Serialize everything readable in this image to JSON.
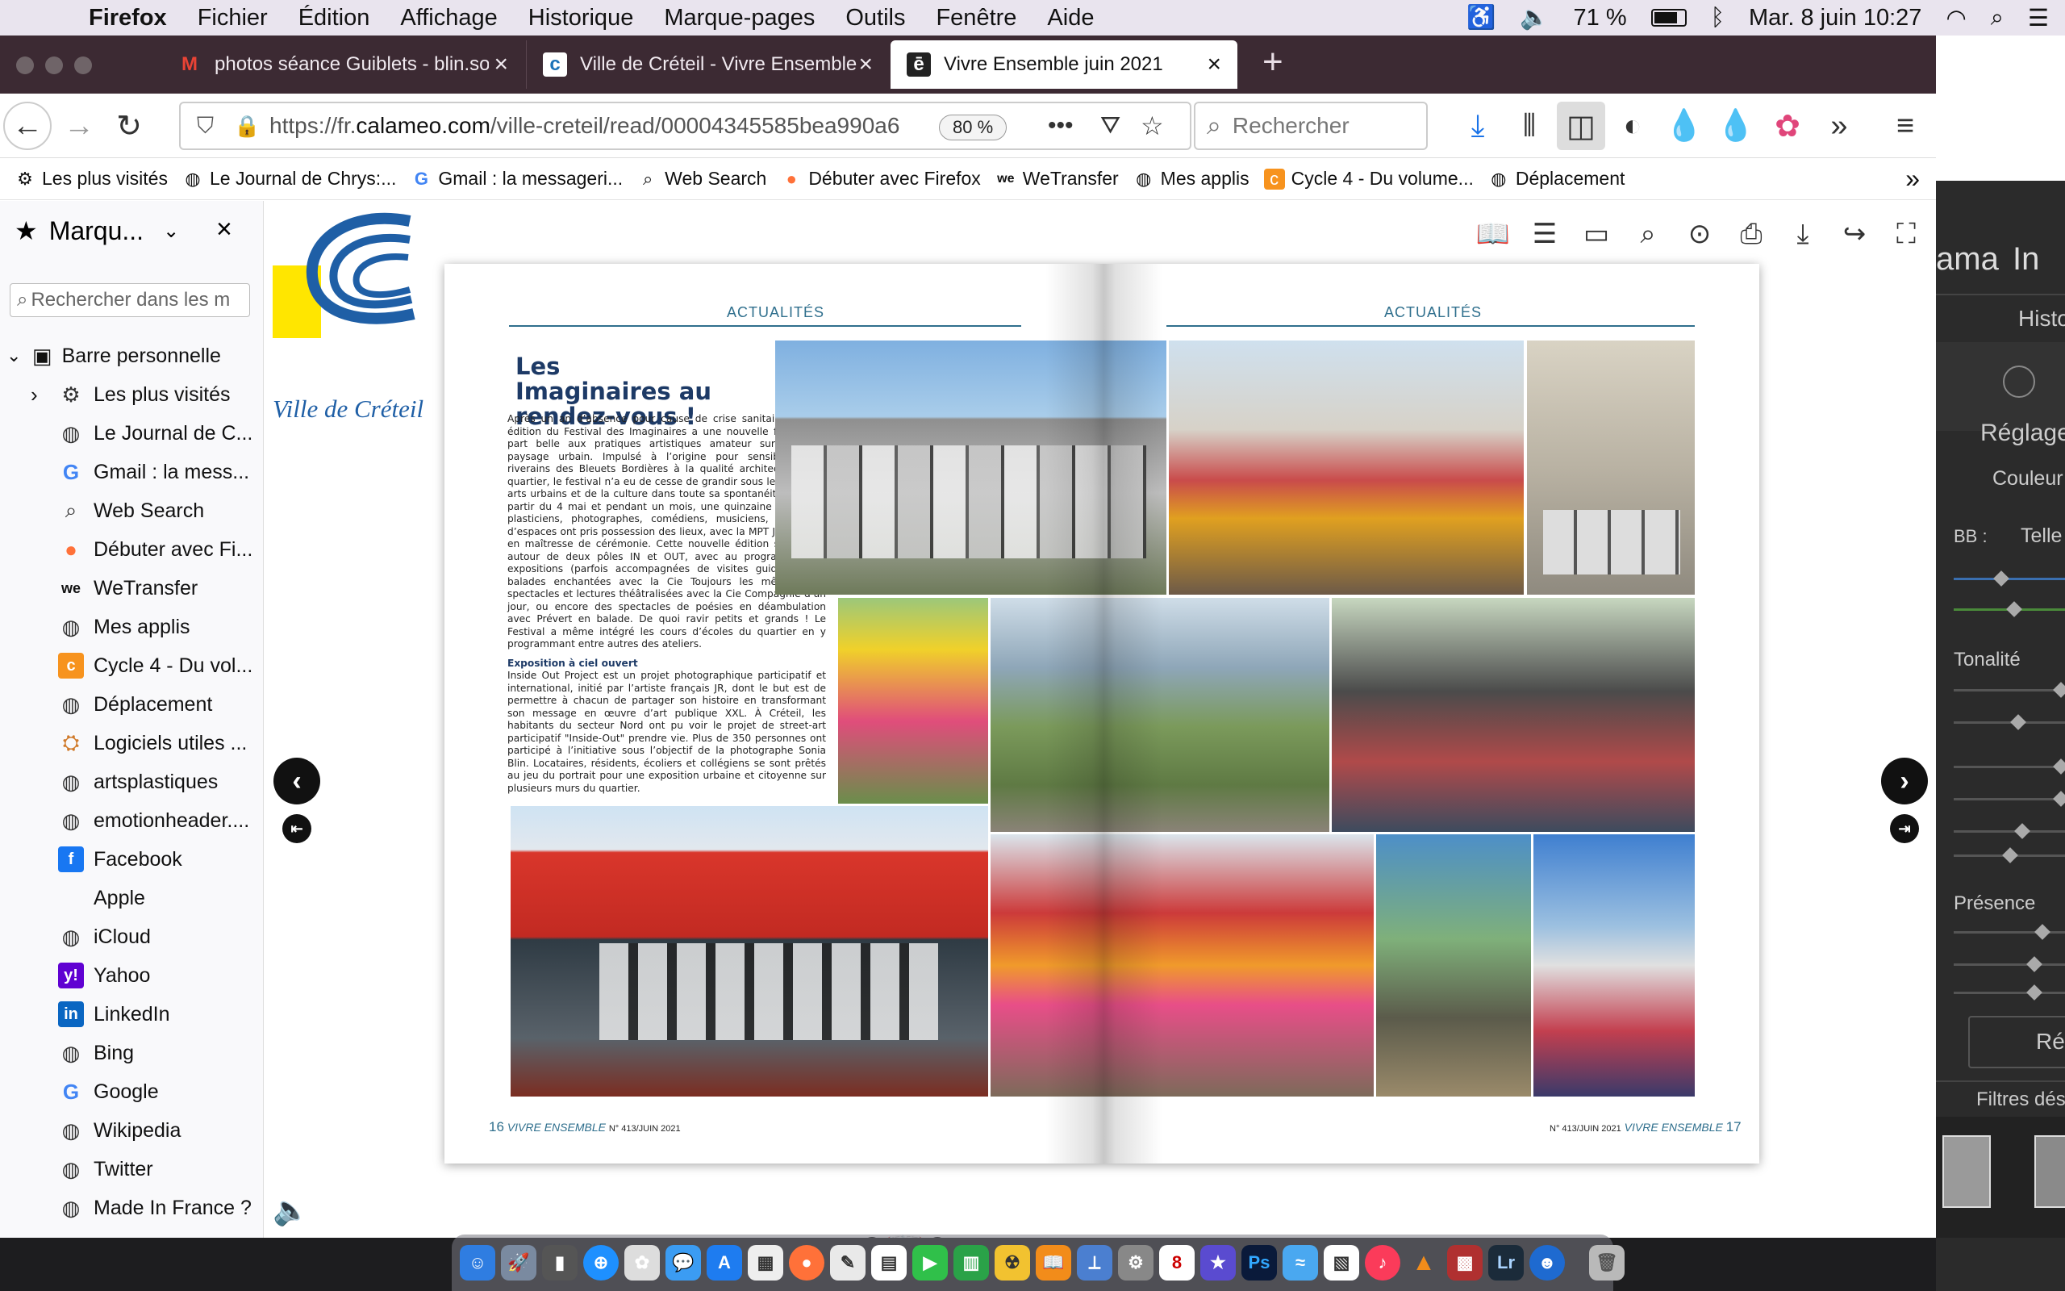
{
  "menubar": {
    "app": "Firefox",
    "menus": [
      "Fichier",
      "Édition",
      "Affichage",
      "Historique",
      "Marque-pages",
      "Outils",
      "Fenêtre",
      "Aide"
    ],
    "battery": "71 %",
    "datetime": "Mar. 8 juin  10:27"
  },
  "tabs": [
    {
      "label": "photos séance Guiblets - blin.sor",
      "icon": "gmail-icon"
    },
    {
      "label": "Ville de Créteil - Vivre Ensemble",
      "icon": "calameo-icon"
    },
    {
      "label": "Vivre Ensemble juin 2021",
      "icon": "calameo-icon"
    }
  ],
  "navbar": {
    "url_prefix": "https://fr.",
    "url_domain": "calameo.com",
    "url_path": "/ville-creteil/read/00004345585bea990a6",
    "zoom": "80 %",
    "search_placeholder": "Rechercher"
  },
  "bookmarks_toolbar": [
    {
      "label": "Les plus visités",
      "icon": "gear-icon"
    },
    {
      "label": "Le Journal de Chrys:...",
      "icon": "globe-icon"
    },
    {
      "label": "Gmail : la messageri...",
      "icon": "google-icon"
    },
    {
      "label": "Web Search",
      "icon": "search-icon"
    },
    {
      "label": "Débuter avec Firefox",
      "icon": "firefox-icon"
    },
    {
      "label": "WeTransfer",
      "icon": "wetransfer-icon"
    },
    {
      "label": "Mes applis",
      "icon": "globe-icon"
    },
    {
      "label": "Cycle 4 - Du volume...",
      "icon": "bookmark-app-icon"
    },
    {
      "label": "Déplacement",
      "icon": "globe-icon"
    }
  ],
  "sidebar": {
    "title": "Marqu...",
    "search_placeholder": "Rechercher dans les m",
    "root": "Barre personnelle",
    "items": [
      {
        "label": "Les plus visités",
        "icon": "gear-icon"
      },
      {
        "label": "Le Journal de C...",
        "icon": "globe-icon"
      },
      {
        "label": "Gmail : la mess...",
        "icon": "google-icon"
      },
      {
        "label": "Web Search",
        "icon": "search-icon"
      },
      {
        "label": "Débuter avec Fi...",
        "icon": "firefox-icon"
      },
      {
        "label": "WeTransfer",
        "icon": "wetransfer-icon"
      },
      {
        "label": "Mes applis",
        "icon": "globe-icon"
      },
      {
        "label": "Cycle 4 - Du vol...",
        "icon": "bookmark-app-icon"
      },
      {
        "label": "Déplacement",
        "icon": "globe-icon"
      },
      {
        "label": "Logiciels utiles ...",
        "icon": "software-icon"
      },
      {
        "label": "artsplastiques",
        "icon": "globe-icon"
      },
      {
        "label": "emotionheader....",
        "icon": "globe-icon"
      },
      {
        "label": "Facebook",
        "icon": "facebook-icon"
      },
      {
        "label": "Apple",
        "icon": "apple-icon"
      },
      {
        "label": "iCloud",
        "icon": "globe-icon"
      },
      {
        "label": "Yahoo",
        "icon": "yahoo-icon"
      },
      {
        "label": "LinkedIn",
        "icon": "linkedin-icon"
      },
      {
        "label": "Bing",
        "icon": "globe-icon"
      },
      {
        "label": "Google",
        "icon": "google-icon"
      },
      {
        "label": "Wikipedia",
        "icon": "globe-icon"
      },
      {
        "label": "Twitter",
        "icon": "globe-icon"
      },
      {
        "label": "Made In France ?",
        "icon": "globe-icon"
      }
    ]
  },
  "publication": {
    "logo_text": "Ville de Créteil",
    "section_left": "ACTUALITÉS",
    "section_right": "ACTUALITÉS",
    "title": "Les Imaginaires au rendez-vous !",
    "body": "Après un an d’absence pour cause de crise sanitaire, la 15e édition du Festival des Imaginaires a une nouvelle fois fait la part belle aux pratiques artistiques amateur sur fond de paysage urbain. Impulsé à l’origine pour sensibiliser les riverains des Bleuets Bordières à la qualité architecturale du quartier, le festival n’a eu de cesse de grandir sous le signe des arts urbains et de la culture dans toute sa spontanéité. Ainsi, à partir du 4 mai et pendant un mois, une quinzaine d’artistes, plasticiens, photographes, comédiens, musiciens, en quête d’espaces ont pris possession des lieux, avec la MPT Jean Ferrat en maîtresse de cérémonie. Cette nouvelle édition s’articulait autour de deux pôles IN et OUT, avec au programme des expositions (parfois accompagnées de visites guidées), des balades enchantées avec la Cie Toujours les mêmes, des spectacles et lectures théâtralisées avec la Cie Compagnie d’un jour, ou encore des spectacles de poésies en déambulation avec Prévert en balade. De quoi ravir petits et grands ! Le Festival a même intégré les cours d’écoles du quartier en y programmant entre autres des ateliers.",
    "subtitle": "Exposition à ciel ouvert",
    "body2": "Inside Out Project est un projet photographique participatif et international, initié par l’artiste français JR, dont le but est de permettre à chacun de partager son histoire en transformant son message en œuvre d’art publique XXL. À Créteil, les habitants du secteur Nord ont pu voir le projet de street-art participatif \"Inside-Out\" prendre vie. Plus de 350 personnes ont participé à l’initiative sous l’objectif de la photographe Sonia Blin. Locataires, résidents, écoliers et collégiens se sont prêtés au jeu du portrait pour une exposition urbaine et citoyenne sur plusieurs murs du quartier.",
    "page_left": "16",
    "page_right": "17",
    "footer_brand": "VIVRE ENSEMBLE",
    "footer_issue": "N° 413/JUIN 2021"
  },
  "lightroom": {
    "labels": [
      "ama",
      "In",
      "Histo",
      "Réglage",
      "Couleur",
      "BB :",
      "Telle",
      "Tonalité",
      "Présence",
      "Réi",
      "Filtres dés"
    ]
  },
  "colors": {
    "accent": "#2f6f8d",
    "title": "#1d3a66",
    "tabbar": "#3c2a33"
  }
}
